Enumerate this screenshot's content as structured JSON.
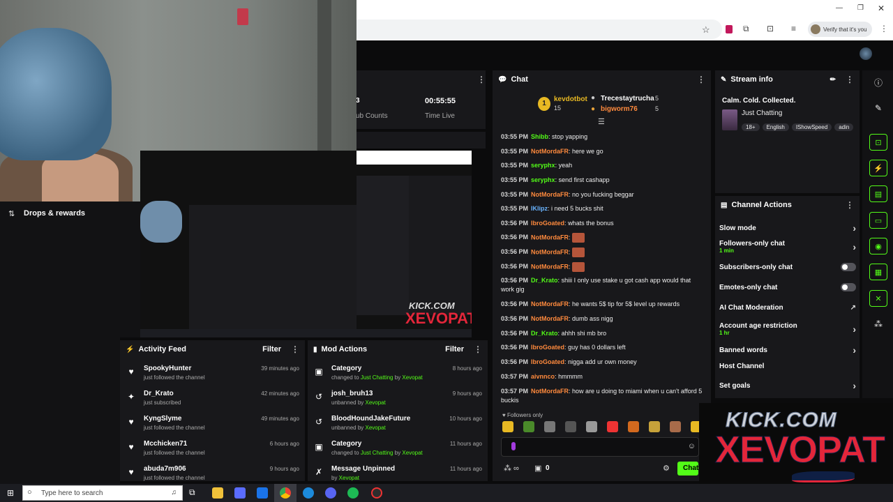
{
  "browser": {
    "profile_prompt": "Verify that it's you"
  },
  "stats": {
    "sub_partial": "3",
    "sub_label": "ub Counts",
    "time_value": "00:55:55",
    "time_label": "Time Live"
  },
  "drops": {
    "title": "Drops & rewards"
  },
  "chat": {
    "title": "Chat",
    "top_gifters": [
      {
        "rank": "1",
        "name": "kevdotbot",
        "count": "15"
      },
      {
        "name": "Trecestaytrucha",
        "count": "5"
      },
      {
        "name": "bigworm76",
        "count": "5"
      }
    ],
    "messages": [
      {
        "time": "03:55 PM",
        "user": "Shibb",
        "text": "stop yapping",
        "color": "#53fc18"
      },
      {
        "time": "03:55 PM",
        "user": "NotMordaFR",
        "text": "here we go",
        "color": "#ff8a3d"
      },
      {
        "time": "03:55 PM",
        "user": "seryphx",
        "text": "yeah",
        "color": "#53fc18"
      },
      {
        "time": "03:55 PM",
        "user": "seryphx",
        "text": "send first cashapp",
        "color": "#53fc18"
      },
      {
        "time": "03:55 PM",
        "user": "NotMordaFR",
        "text": "no you fucking beggar",
        "color": "#ff8a3d"
      },
      {
        "time": "03:55 PM",
        "user": "lKlipz",
        "text": "i need 5 bucks shit",
        "color": "#69b4ff"
      },
      {
        "time": "03:56 PM",
        "user": "lbroGoated",
        "text": "whats the bonus",
        "color": "#ff8a3d"
      },
      {
        "time": "03:56 PM",
        "user": "NotMordaFR",
        "text": "",
        "color": "#ff8a3d"
      },
      {
        "time": "03:56 PM",
        "user": "NotMordaFR",
        "text": "",
        "color": "#ff8a3d"
      },
      {
        "time": "03:56 PM",
        "user": "NotMordaFR",
        "text": "",
        "color": "#ff8a3d"
      },
      {
        "time": "03:56 PM",
        "user": "Dr_Krato",
        "text": "shiii I only use stake u got cash app would that work gig",
        "color": "#53fc18"
      },
      {
        "time": "03:56 PM",
        "user": "NotMordaFR",
        "text": "he wants 5$ tip for 5$ level up rewards",
        "color": "#ff8a3d"
      },
      {
        "time": "03:56 PM",
        "user": "NotMordaFR",
        "text": "dumb ass nigg",
        "color": "#ff8a3d"
      },
      {
        "time": "03:56 PM",
        "user": "Dr_Krato",
        "text": "ahhh shi mb bro",
        "color": "#53fc18"
      },
      {
        "time": "03:56 PM",
        "user": "lbroGoated",
        "text": "guy has 0 dollars left",
        "color": "#ff8a3d"
      },
      {
        "time": "03:56 PM",
        "user": "lbroGoated",
        "text": "nigga add ur own money",
        "color": "#ff8a3d"
      },
      {
        "time": "03:57 PM",
        "user": "aivnnco",
        "text": "hmmmm",
        "color": "#ff8a3d"
      },
      {
        "time": "03:57 PM",
        "user": "NotMordaFR",
        "text": "how are u doing to miami when u can't afford 5 buckis",
        "color": "#ff8a3d"
      }
    ],
    "followers_only": "Followers only",
    "bottom_count": "0",
    "send_label": "Chat"
  },
  "stream_info": {
    "title": "Stream info",
    "stream_title": "Calm. Cold. Collected.",
    "category": "Just Chatting",
    "tags": [
      "18+",
      "English",
      "IShowSpeed",
      "adin"
    ]
  },
  "channel_actions": {
    "title": "Channel Actions",
    "items": [
      {
        "label": "Slow mode",
        "sub": ""
      },
      {
        "label": "Followers-only chat",
        "sub": "1 min"
      },
      {
        "label": "Subscribers-only chat",
        "sub": ""
      },
      {
        "label": "Emotes-only chat",
        "sub": ""
      },
      {
        "label": "AI Chat Moderation",
        "sub": ""
      },
      {
        "label": "Account age restriction",
        "sub": "1 hr"
      },
      {
        "label": "Banned words",
        "sub": ""
      },
      {
        "label": "Host Channel",
        "sub": ""
      },
      {
        "label": "Set goals",
        "sub": ""
      }
    ]
  },
  "activity_feed": {
    "title": "Activity Feed",
    "filter": "Filter",
    "items": [
      {
        "name": "SpookyHunter",
        "action": "just followed the channel",
        "time": "39 minutes ago",
        "icon": "heart-icon"
      },
      {
        "name": "Dr_Krato",
        "action": "just subscribed",
        "time": "42 minutes ago",
        "icon": "sparkle-icon"
      },
      {
        "name": "KyngSlyme",
        "action": "just followed the channel",
        "time": "49 minutes ago",
        "icon": "heart-icon"
      },
      {
        "name": "Mcchicken71",
        "action": "just followed the channel",
        "time": "6 hours ago",
        "icon": "heart-icon"
      },
      {
        "name": "abuda7m906",
        "action": "just followed the channel",
        "time": "9 hours ago",
        "icon": "heart-icon"
      }
    ]
  },
  "mod_actions": {
    "title": "Mod Actions",
    "filter": "Filter",
    "items": [
      {
        "name": "Category",
        "pre": "changed to ",
        "target": "Just Chatting",
        "mid": " by ",
        "by": "Xevopat",
        "time": "8 hours ago"
      },
      {
        "name": "josh_bruh13",
        "pre": "unbanned by ",
        "target": "",
        "mid": "",
        "by": "Xevopat",
        "time": "9 hours ago"
      },
      {
        "name": "BloodHoundJakeFuture",
        "pre": "unbanned by ",
        "target": "",
        "mid": "",
        "by": "Xevopat",
        "time": "10 hours ago"
      },
      {
        "name": "Category",
        "pre": "changed to ",
        "target": "Just Chatting",
        "mid": " by ",
        "by": "Xevopat",
        "time": "11 hours ago"
      },
      {
        "name": "Message Unpinned",
        "pre": "by ",
        "target": "",
        "mid": "",
        "by": "Xevopat",
        "time": "11 hours ago"
      }
    ]
  },
  "overlay": {
    "line1": "KICK.COM",
    "line2": "XEVOPAT"
  },
  "taskbar": {
    "search_placeholder": "Type here to search"
  },
  "colors": {
    "accent": "#53fc18",
    "panel": "#18181b",
    "username_orange": "#ff8a3d"
  }
}
